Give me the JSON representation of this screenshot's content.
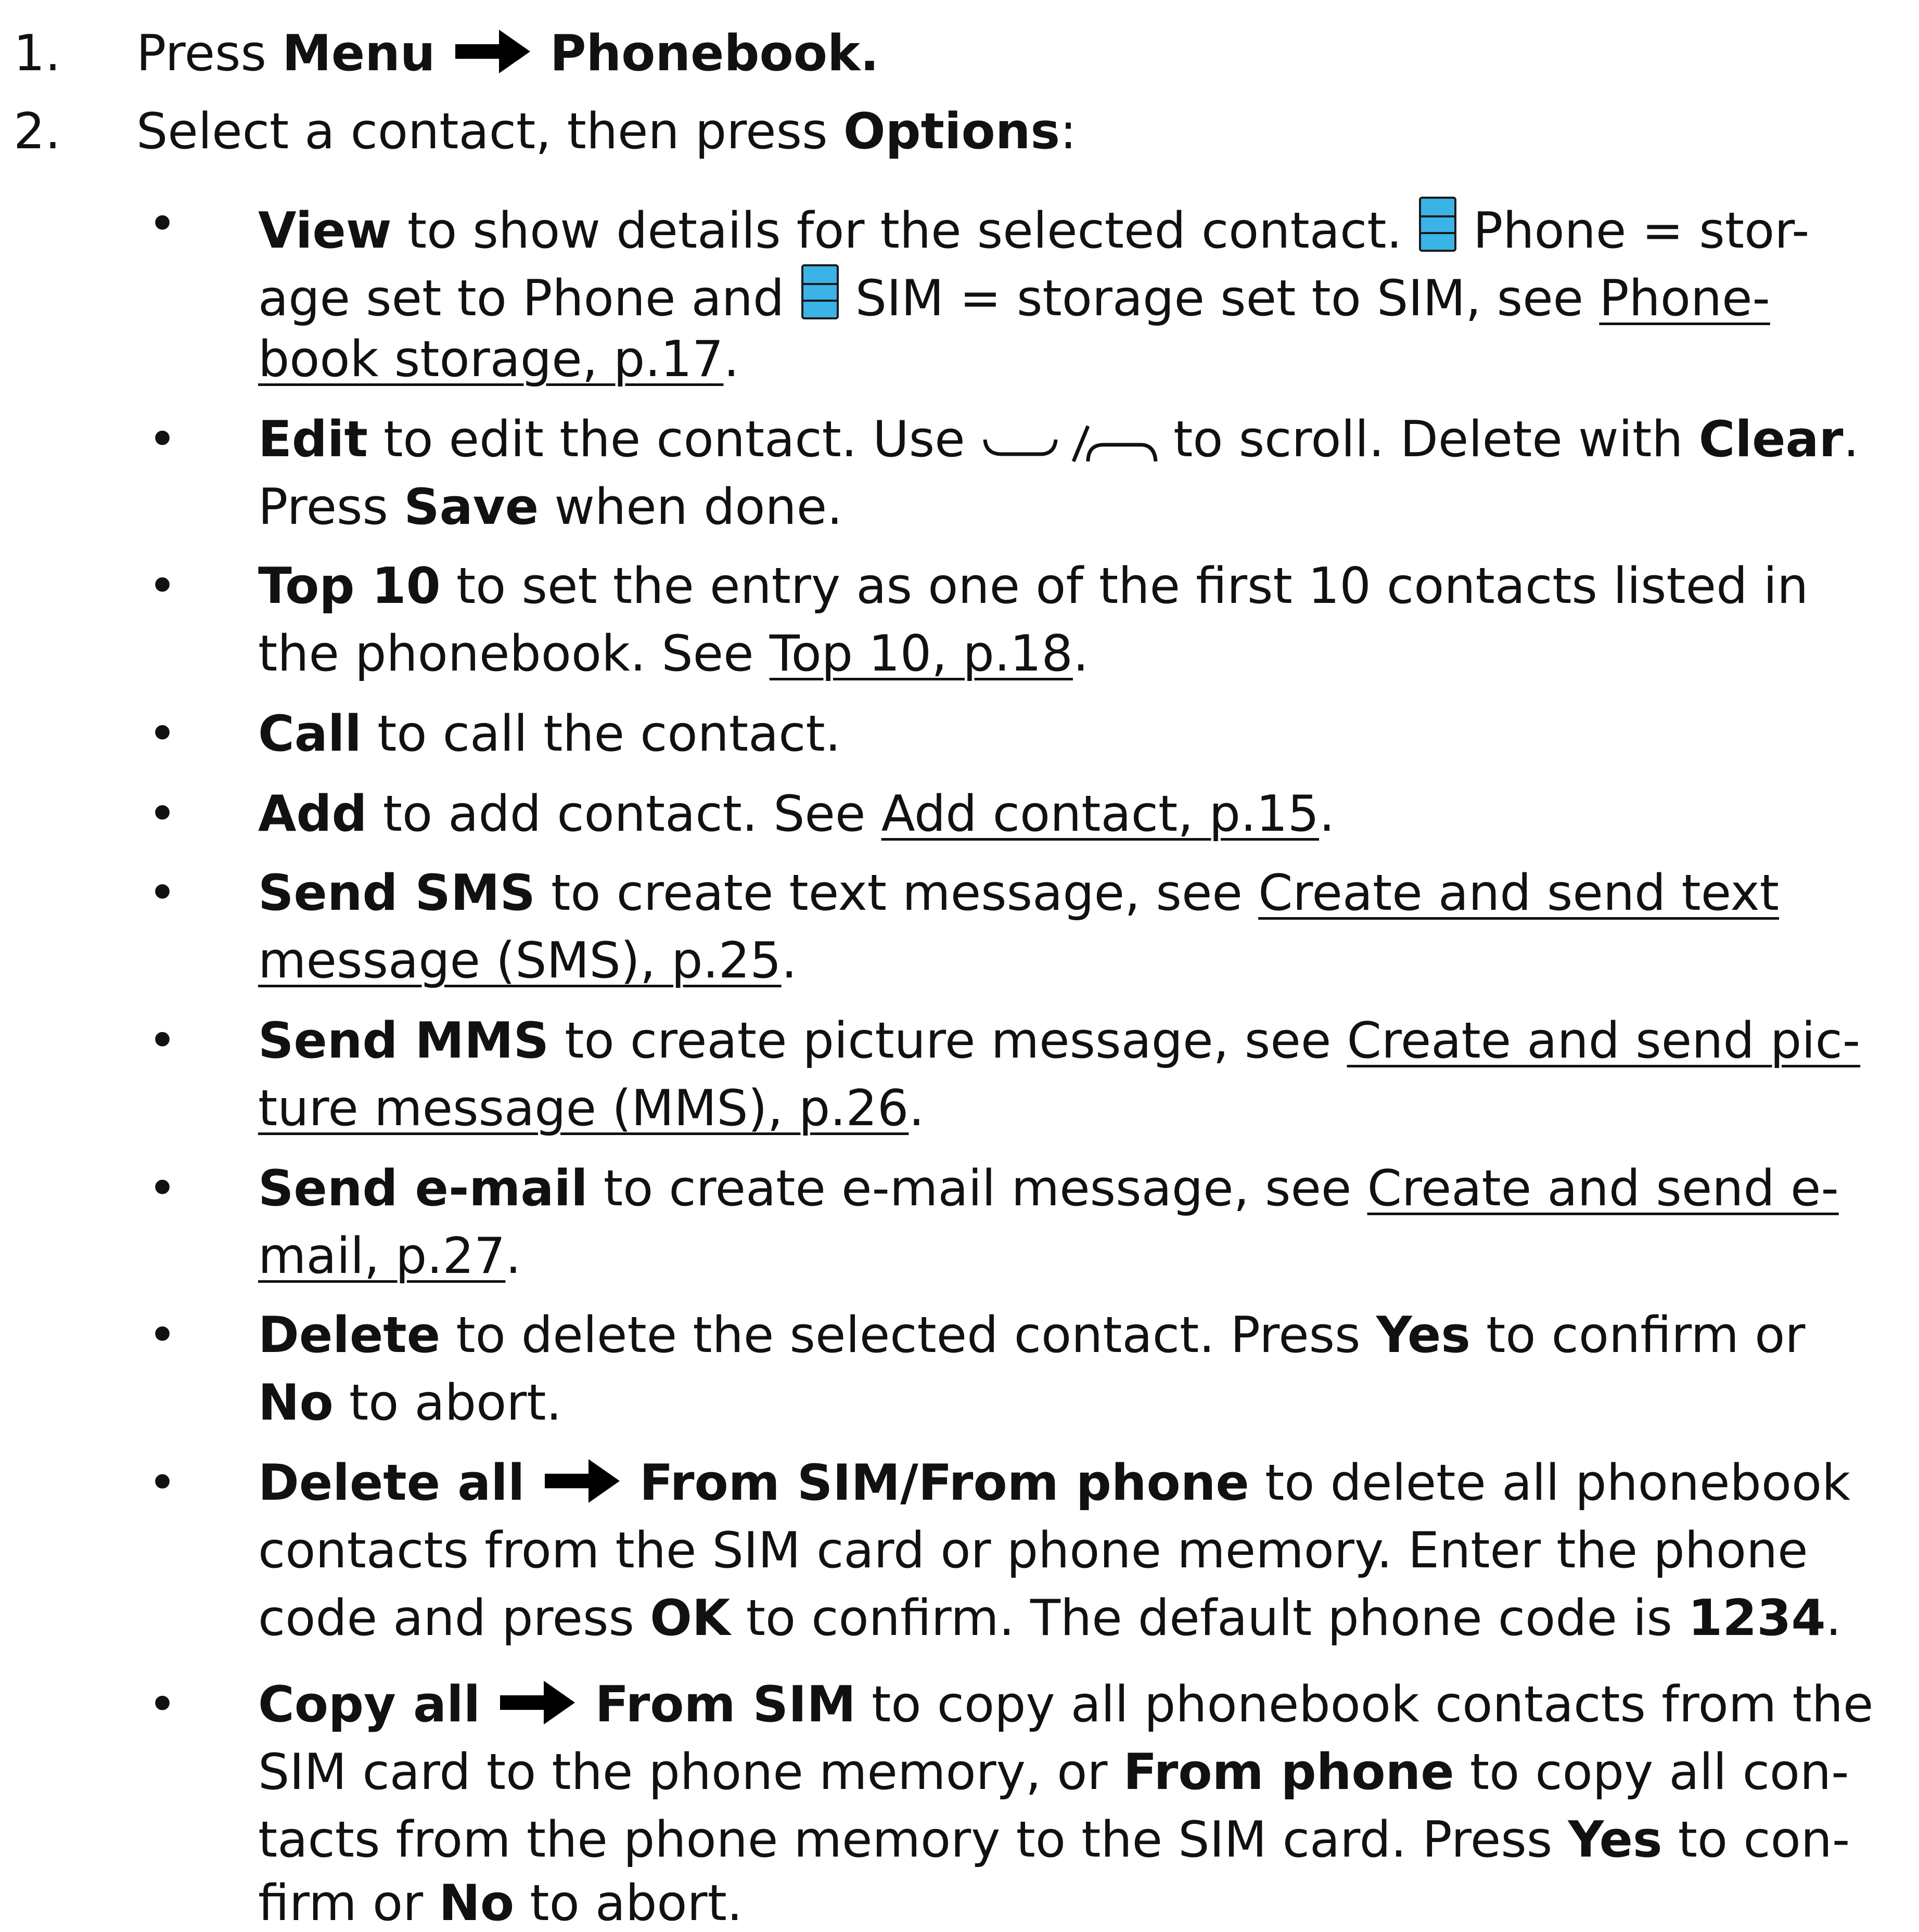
{
  "steps": [
    {
      "number": "1.",
      "t1": "Press ",
      "menu": "Menu",
      "phonebook": "Phonebook."
    },
    {
      "number": "2.",
      "t1": "Select a contact, then press ",
      "options": "Options",
      "t2": ":"
    }
  ],
  "bullet_char": "•",
  "view": {
    "term": "View",
    "t1": " to show details for the selected contact. ",
    "t2": " Phone = stor-",
    "t3": "age set to Phone and ",
    "t4": " SIM = storage set to SIM, see ",
    "link_a": "Phone-",
    "link_b": "book storage, p.17",
    "end": "."
  },
  "edit": {
    "term": "Edit",
    "t1": " to edit the contact. Use ",
    "t2": " to scroll. Delete with ",
    "clear": "Clear",
    "end": ".",
    "t3": "Press ",
    "save": "Save",
    "t4": " when done."
  },
  "top10": {
    "term": "Top 10",
    "t1": " to set the entry as one of the first 10 contacts listed in",
    "t2": "the phonebook. See ",
    "link": "Top 10, p.18",
    "end": "."
  },
  "call": {
    "term": "Call",
    "t1": " to call the contact."
  },
  "add": {
    "term": "Add",
    "t1": " to add contact. See ",
    "link": "Add contact, p.15",
    "end": "."
  },
  "sms": {
    "term": "Send SMS",
    "t1": " to create text message, see ",
    "link_a": "Create and send text",
    "link_b": "message (SMS), p.25",
    "end": "."
  },
  "mms": {
    "term": "Send MMS",
    "t1": " to create picture message, see ",
    "link_a": "Create and send pic-",
    "link_b": "ture message (MMS), p.26",
    "end": "."
  },
  "email": {
    "term": "Send e-mail",
    "t1": " to create e-mail message, see ",
    "link_a": "Create and send e-",
    "link_b": "mail, p.27",
    "end": "."
  },
  "delete": {
    "term": "Delete",
    "t1": " to delete the selected contact. Press ",
    "yes": "Yes",
    "t2": " to confirm or",
    "no": "No",
    "t3": " to abort."
  },
  "delete_all": {
    "term": "Delete all",
    "path": "From SIM/From phone",
    "t1": " to delete all phonebook",
    "line2": "contacts from the SIM card or phone memory. Enter the phone",
    "t2": "code and press ",
    "ok": "OK",
    "t3": " to confirm. The default phone code is ",
    "code": "1234",
    "end": "."
  },
  "copy_all": {
    "term": "Copy all",
    "path": "From SIM",
    "t1": " to copy all phonebook contacts from the",
    "t2": "SIM card to the phone memory, or ",
    "from_phone": "From phone",
    "t3": " to copy all con-",
    "t4": "tacts from the phone memory to the SIM card. Press ",
    "yes": "Yes",
    "t5": " to con-",
    "t6": "firm or ",
    "no": "No",
    "t7": " to abort."
  },
  "icons": {
    "arrow": "right-arrow-icon",
    "phone_storage": "phone-storage-icon",
    "sim_storage": "sim-storage-icon",
    "nav_keys": "scroll-down-up-keys-icon",
    "storage_icon_color": "#3ab4e6"
  }
}
